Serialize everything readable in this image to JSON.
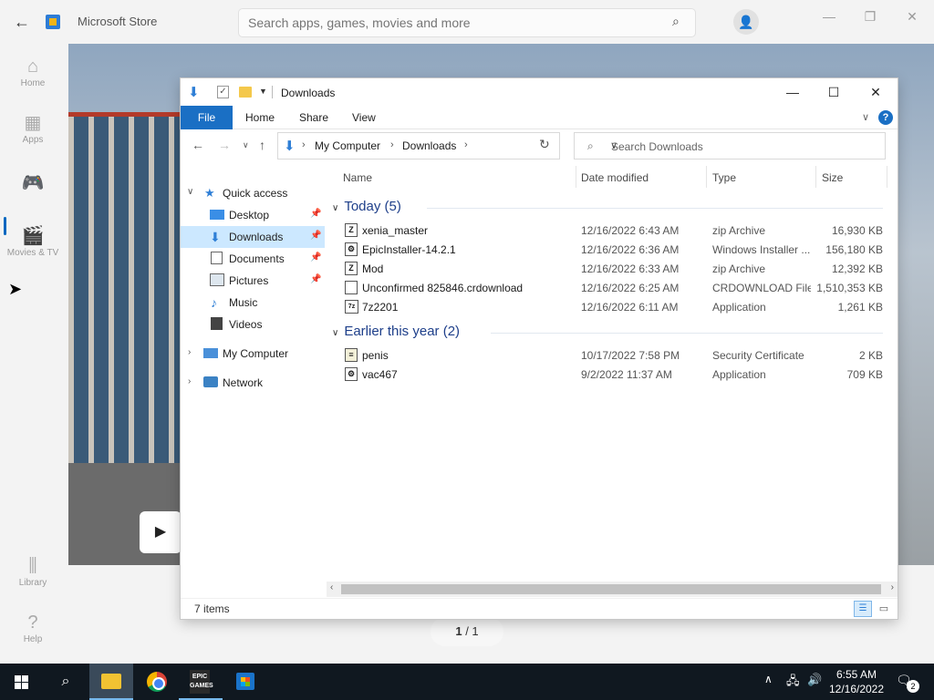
{
  "store": {
    "title": "Microsoft Store",
    "search_placeholder": "Search apps, games, movies and more",
    "nav": [
      {
        "label": "Home",
        "icon": "home-icon"
      },
      {
        "label": "Apps",
        "icon": "apps-icon"
      },
      {
        "label": "",
        "icon": "gaming-icon"
      },
      {
        "label": "Movies & TV",
        "icon": "movies-icon"
      },
      {
        "label": "Library",
        "icon": "library-icon"
      },
      {
        "label": "Help",
        "icon": "help-icon"
      }
    ],
    "pager": {
      "current": "1",
      "total": "/ 1"
    }
  },
  "explorer": {
    "title": "Downloads",
    "ribbon": [
      "File",
      "Home",
      "Share",
      "View"
    ],
    "breadcrumb": [
      "My Computer",
      "Downloads"
    ],
    "search_placeholder": "Search Downloads",
    "nav_tree": {
      "quick_access": "Quick access",
      "items": [
        "Desktop",
        "Downloads",
        "Documents",
        "Pictures",
        "Music",
        "Videos"
      ],
      "my_computer": "My Computer",
      "network": "Network"
    },
    "columns": [
      "Name",
      "Date modified",
      "Type",
      "Size"
    ],
    "groups": [
      {
        "label": "Today (5)",
        "files": [
          {
            "name": "xenia_master",
            "date": "12/16/2022 6:43 AM",
            "type": "zip Archive",
            "size": "16,930 KB"
          },
          {
            "name": "EpicInstaller-14.2.1",
            "date": "12/16/2022 6:36 AM",
            "type": "Windows Installer ...",
            "size": "156,180 KB"
          },
          {
            "name": "Mod",
            "date": "12/16/2022 6:33 AM",
            "type": "zip Archive",
            "size": "12,392 KB"
          },
          {
            "name": "Unconfirmed 825846.crdownload",
            "date": "12/16/2022 6:25 AM",
            "type": "CRDOWNLOAD File",
            "size": "1,510,353 KB"
          },
          {
            "name": "7z2201",
            "date": "12/16/2022 6:11 AM",
            "type": "Application",
            "size": "1,261 KB"
          }
        ]
      },
      {
        "label": "Earlier this year (2)",
        "files": [
          {
            "name": "penis",
            "date": "10/17/2022 7:58 PM",
            "type": "Security Certificate",
            "size": "2 KB"
          },
          {
            "name": "vac467",
            "date": "9/2/2022 11:37 AM",
            "type": "Application",
            "size": "709 KB"
          }
        ]
      }
    ],
    "status": "7 items"
  },
  "taskbar": {
    "epic_label": "EPIC GAMES",
    "clock_time": "6:55 AM",
    "clock_date": "12/16/2022",
    "notification_count": "2"
  }
}
